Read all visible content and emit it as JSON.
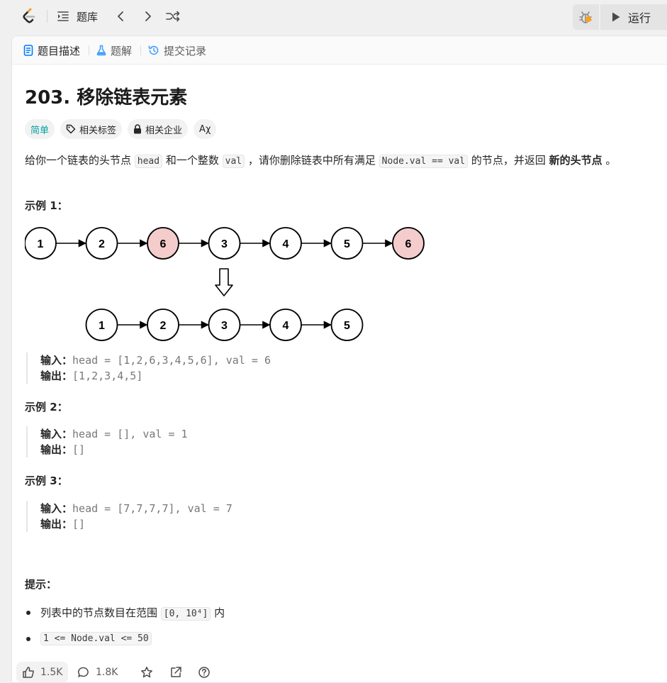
{
  "nav": {
    "library_label": "题库",
    "run_label": "运行"
  },
  "tabs": [
    {
      "label": "题目描述"
    },
    {
      "label": "题解"
    },
    {
      "label": "提交记录"
    }
  ],
  "problem": {
    "title": "203. 移除链表元素",
    "tags": {
      "difficulty": "简单",
      "related_tags": "相关标签",
      "related_companies": "相关企业",
      "translate": "Aχ"
    },
    "description": {
      "p1": "给你一个链表的头节点 ",
      "c1": "head",
      "p2": " 和一个整数 ",
      "c2": "val",
      "p3": " ，请你删除链表中所有满足 ",
      "c3": "Node.val == val",
      "p4": " 的节点，并返回 ",
      "bold": "新的头节点",
      "p5": " 。"
    },
    "diagram": {
      "top_row": [
        "1",
        "2",
        "6",
        "3",
        "4",
        "5",
        "6"
      ],
      "top_removed": [
        false,
        false,
        true,
        false,
        false,
        false,
        true
      ],
      "bottom_row": [
        "1",
        "2",
        "3",
        "4",
        "5"
      ],
      "removed_color": "#f4cccc"
    },
    "examples": [
      {
        "heading": "示例 1：",
        "input_label": "输入：",
        "input": "head = [1,2,6,3,4,5,6], val = 6",
        "output_label": "输出：",
        "output": "[1,2,3,4,5]"
      },
      {
        "heading": "示例 2：",
        "input_label": "输入：",
        "input": "head = [], val = 1",
        "output_label": "输出：",
        "output": "[]"
      },
      {
        "heading": "示例 3：",
        "input_label": "输入：",
        "input": "head = [7,7,7,7], val = 7",
        "output_label": "输出：",
        "output": "[]"
      }
    ],
    "hints": {
      "heading": "提示：",
      "h1_pre": "列表中的节点数目在范围 ",
      "h1_code": "[0, 10⁴]",
      "h1_post": " 内",
      "h2_code": "1 <= Node.val <= 50"
    }
  },
  "footer": {
    "likes": "1.5K",
    "comments": "1.8K"
  },
  "colors": {
    "easy": "#00a3a3",
    "accent": "#ffa116"
  }
}
